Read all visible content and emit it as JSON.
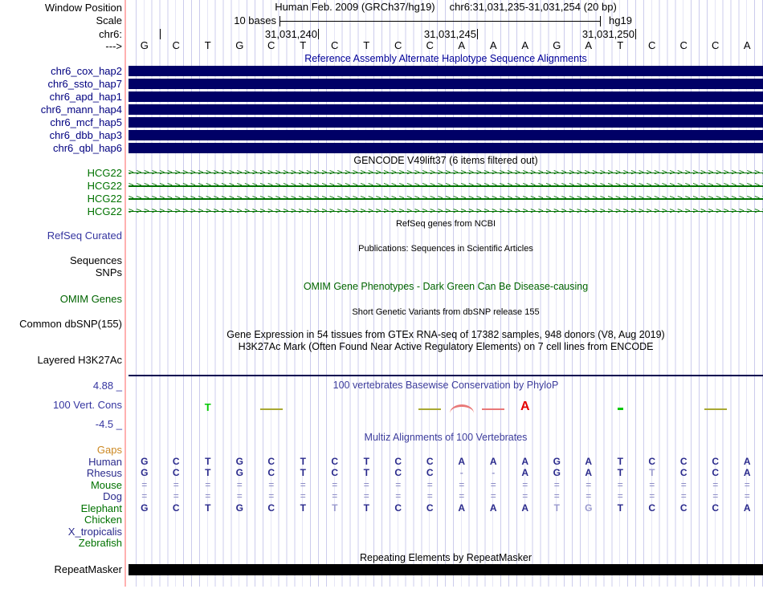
{
  "colors": {
    "grid_line": "#ccccec",
    "guideline_pink": "#ffb0b0",
    "bar_navy": "#000066",
    "hap_label_navy": "#000080",
    "title_blue": "#000099",
    "track_label_blue": "#3535a0",
    "cons_title_blue": "#3c3c9c",
    "gene_green": "#007200",
    "omim_green": "#006400",
    "gaps_orange": "#cc8822",
    "species_blue": "#2a2a8c",
    "align_letter": "#2a2a8c",
    "align_faint": "#9a9ace",
    "align_double": "#8080c0",
    "cons_green": "#00c800",
    "cons_olive": "#a8a832",
    "cons_salmon": "#e87878",
    "cons_red": "#e60000",
    "repeat_black": "#000000"
  },
  "header": {
    "assembly": "Human Feb. 2009 (GRCh37/hg19)",
    "position": "chr6:31,031,235-31,031,254 (20 bp)"
  },
  "left_column": {
    "window_position": "Window Position",
    "scale": "Scale",
    "chrom": "chr6:",
    "strand_arrow": "--->"
  },
  "scale_bar": {
    "label": "10 bases",
    "genome": "hg19"
  },
  "ruler": {
    "tick_labels": [
      "31,031,240",
      "31,031,245",
      "31,031,250"
    ]
  },
  "sequence": [
    "G",
    "C",
    "T",
    "G",
    "C",
    "T",
    "C",
    "T",
    "C",
    "C",
    "A",
    "A",
    "A",
    "G",
    "A",
    "T",
    "C",
    "C",
    "C",
    "A"
  ],
  "haplotypes": {
    "title": "Reference Assembly Alternate Haplotype Sequence Alignments",
    "tracks": [
      "chr6_cox_hap2",
      "chr6_ssto_hap7",
      "chr6_apd_hap1",
      "chr6_mann_hap4",
      "chr6_mcf_hap5",
      "chr6_dbb_hap3",
      "chr6_qbl_hap6"
    ]
  },
  "gencode": {
    "title": "GENCODE V49lift37 (6 items filtered out)",
    "genes": [
      "HCG22",
      "HCG22",
      "HCG22",
      "HCG22"
    ]
  },
  "refseq": {
    "title": "RefSeq genes from NCBI",
    "label": "RefSeq Curated"
  },
  "publications": {
    "title": "Publications: Sequences in Scientific Articles",
    "labels": [
      "Sequences",
      "SNPs"
    ]
  },
  "omim": {
    "title": "OMIM Gene Phenotypes - Dark Green Can Be Disease-causing",
    "label": "OMIM Genes"
  },
  "dbsnp": {
    "title": "Short Genetic Variants from dbSNP release 155",
    "label": "Common dbSNP(155)"
  },
  "gtex": {
    "title": "Gene Expression in 54 tissues from GTEx RNA-seq of 17382 samples, 948 donors (V8, Aug 2019)"
  },
  "h3k27ac": {
    "title": "H3K27Ac Mark (Often Found Near Active Regulatory Elements) on 7 cell lines from ENCODE",
    "label": "Layered H3K27Ac"
  },
  "conservation": {
    "title": "100 vertebrates Basewise Conservation by PhyloP",
    "label": "100 Vert. Cons",
    "axis_top": "4.88 _",
    "axis_bottom": "-4.5 _",
    "marks": [
      {
        "col": 3,
        "kind": "letter",
        "glyph": "T",
        "color_key": "cons_green"
      },
      {
        "col": 5,
        "kind": "dash",
        "color_key": "cons_olive"
      },
      {
        "col": 10,
        "kind": "dash",
        "color_key": "cons_olive"
      },
      {
        "col": 11,
        "kind": "arc",
        "color_key": "cons_salmon"
      },
      {
        "col": 12,
        "kind": "dash",
        "color_key": "cons_salmon"
      },
      {
        "col": 13,
        "kind": "letter",
        "glyph": "A",
        "color_key": "cons_red"
      },
      {
        "col": 16,
        "kind": "tick",
        "color_key": "cons_green"
      },
      {
        "col": 19,
        "kind": "dash",
        "color_key": "cons_olive"
      }
    ]
  },
  "multiz": {
    "title": "Multiz Alignments of 100 Vertebrates",
    "rows": [
      {
        "species": "Gaps",
        "color_key": "gaps_orange",
        "bases": [],
        "faint": []
      },
      {
        "species": "Human",
        "color_key": "species_blue",
        "bases": [
          "G",
          "C",
          "T",
          "G",
          "C",
          "T",
          "C",
          "T",
          "C",
          "C",
          "A",
          "A",
          "A",
          "G",
          "A",
          "T",
          "C",
          "C",
          "C",
          "A"
        ],
        "faint": []
      },
      {
        "species": "Rhesus",
        "color_key": "species_blue",
        "bases": [
          "G",
          "C",
          "T",
          "G",
          "C",
          "T",
          "C",
          "T",
          "C",
          "C",
          "-",
          "-",
          "A",
          "G",
          "A",
          "T",
          "T",
          "C",
          "C",
          "A"
        ],
        "faint": [
          10,
          11,
          16
        ]
      },
      {
        "species": "Mouse",
        "color_key": "gene_green",
        "bases": [
          "=",
          "=",
          "=",
          "=",
          "=",
          "=",
          "=",
          "=",
          "=",
          "=",
          "=",
          "=",
          "=",
          "=",
          "=",
          "=",
          "=",
          "=",
          "=",
          "="
        ],
        "faint": []
      },
      {
        "species": "Dog",
        "color_key": "species_blue",
        "bases": [
          "=",
          "=",
          "=",
          "=",
          "=",
          "=",
          "=",
          "=",
          "=",
          "=",
          "=",
          "=",
          "=",
          "=",
          "=",
          "=",
          "=",
          "=",
          "=",
          "="
        ],
        "faint": []
      },
      {
        "species": "Elephant",
        "color_key": "gene_green",
        "bases": [
          "G",
          "C",
          "T",
          "G",
          "C",
          "T",
          "T",
          "T",
          "C",
          "C",
          "A",
          "A",
          "A",
          "T",
          "G",
          "T",
          "C",
          "C",
          "C",
          "A"
        ],
        "faint": [
          6,
          13,
          14
        ]
      },
      {
        "species": "Chicken",
        "color_key": "gene_green",
        "bases": [],
        "faint": []
      },
      {
        "species": "X_tropicalis",
        "color_key": "species_blue",
        "bases": [],
        "faint": []
      },
      {
        "species": "Zebrafish",
        "color_key": "gene_green",
        "bases": [],
        "faint": []
      }
    ]
  },
  "repeatmasker": {
    "title": "Repeating Elements by RepeatMasker",
    "label": "RepeatMasker"
  }
}
